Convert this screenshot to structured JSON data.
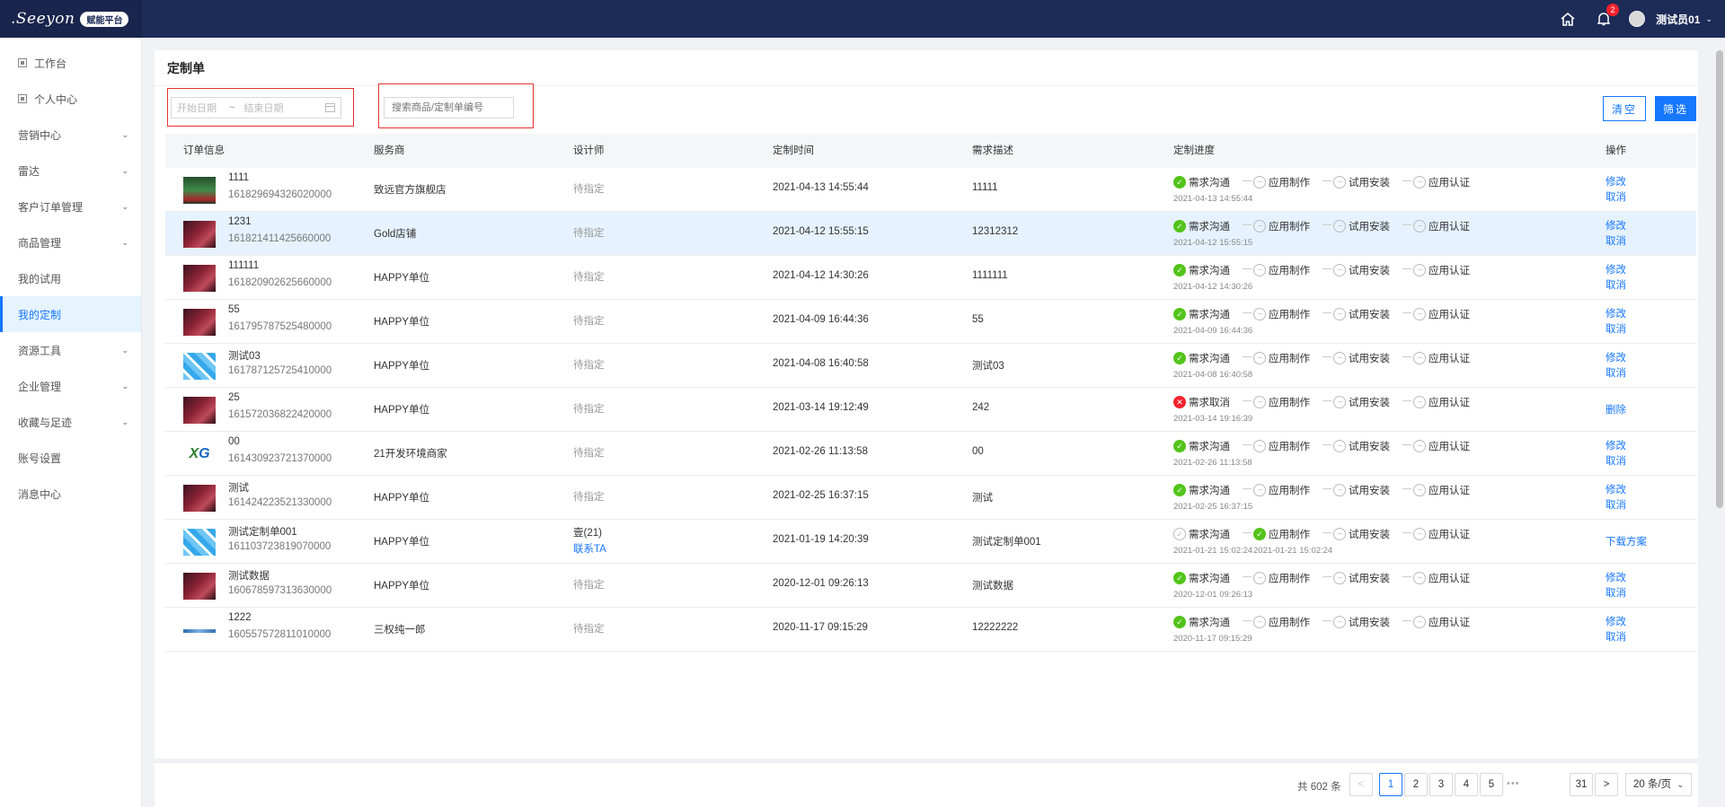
{
  "header": {
    "logo_text": ".Seeyon",
    "logo_badge": "赋能平台",
    "bell_count": "2",
    "user_name": "测试员01"
  },
  "sidebar": {
    "items": [
      {
        "label": "工作台",
        "icon": "page-icon",
        "caret": false,
        "active": false
      },
      {
        "label": "个人中心",
        "icon": "page-icon",
        "caret": false,
        "active": false
      },
      {
        "label": "营销中心",
        "caret": true,
        "active": false
      },
      {
        "label": "雷达",
        "caret": true,
        "active": false
      },
      {
        "label": "客户订单管理",
        "caret": true,
        "active": false
      },
      {
        "label": "商品管理",
        "caret": true,
        "active": false
      },
      {
        "label": "我的试用",
        "caret": false,
        "active": false
      },
      {
        "label": "我的定制",
        "caret": false,
        "active": true
      },
      {
        "label": "资源工具",
        "caret": true,
        "active": false
      },
      {
        "label": "企业管理",
        "caret": true,
        "active": false
      },
      {
        "label": "收藏与足迹",
        "caret": true,
        "active": false
      },
      {
        "label": "账号设置",
        "caret": false,
        "active": false
      },
      {
        "label": "消息中心",
        "caret": false,
        "active": false
      }
    ]
  },
  "page": {
    "title": "定制单",
    "start_placeholder": "开始日期",
    "range_sep": "~",
    "end_placeholder": "结束日期",
    "search_placeholder": "搜索商品/定制单编号",
    "clear_label": "清空",
    "filter_label": "筛选"
  },
  "table": {
    "headers": [
      "订单信息",
      "服务商",
      "设计师",
      "定制时间",
      "需求描述",
      "定制进度",
      "操作"
    ],
    "steps": [
      "需求沟通",
      "应用制作",
      "试用安装",
      "应用认证"
    ],
    "cancel_step": "需求取消",
    "rows": [
      {
        "thumb": "green",
        "name": "1111",
        "no": "161829694326020000",
        "provider": "致远官方旗舰店",
        "designer": "待指定",
        "time": "2021-04-13 14:55:44",
        "desc": "11111",
        "s1": "ok",
        "t1": "2021-04-13 14:55:44",
        "ops": [
          "修改",
          "取消"
        ]
      },
      {
        "thumb": "red",
        "name": "1231",
        "no": "161821411425660000",
        "provider": "Gold店铺",
        "designer": "待指定",
        "time": "2021-04-12 15:55:15",
        "desc": "12312312",
        "s1": "ok",
        "t1": "2021-04-12 15:55:15",
        "ops": [
          "修改",
          "取消"
        ],
        "highlight": true
      },
      {
        "thumb": "red",
        "name": "111111",
        "no": "161820902625660000",
        "provider": "HAPPY单位",
        "designer": "待指定",
        "time": "2021-04-12 14:30:26",
        "desc": "1111111",
        "s1": "ok",
        "t1": "2021-04-12 14:30:26",
        "ops": [
          "修改",
          "取消"
        ]
      },
      {
        "thumb": "red",
        "name": "55",
        "no": "161795787525480000",
        "provider": "HAPPY单位",
        "designer": "待指定",
        "time": "2021-04-09 16:44:36",
        "desc": "55",
        "s1": "ok",
        "t1": "2021-04-09 16:44:36",
        "ops": [
          "修改",
          "取消"
        ]
      },
      {
        "thumb": "blue",
        "name": "测试03",
        "no": "161787125725410000",
        "provider": "HAPPY单位",
        "designer": "待指定",
        "time": "2021-04-08 16:40:58",
        "desc": "测试03",
        "s1": "ok",
        "t1": "2021-04-08 16:40:58",
        "ops": [
          "修改",
          "取消"
        ]
      },
      {
        "thumb": "red",
        "name": "25",
        "no": "161572036822420000",
        "provider": "HAPPY单位",
        "designer": "待指定",
        "time": "2021-03-14 19:12:49",
        "desc": "242",
        "s1": "err",
        "t1": "2021-03-14 19:16:39",
        "ops": [
          "删除"
        ]
      },
      {
        "thumb": "logo",
        "name": "00",
        "no": "161430923721370000",
        "provider": "21开发环境商家",
        "designer": "待指定",
        "time": "2021-02-26 11:13:58",
        "desc": "00",
        "s1": "ok",
        "t1": "2021-02-26 11:13:58",
        "ops": [
          "修改",
          "取消"
        ]
      },
      {
        "thumb": "red",
        "name": "测试",
        "no": "161424223521330000",
        "provider": "HAPPY单位",
        "designer": "待指定",
        "time": "2021-02-25 16:37:15",
        "desc": "测试",
        "s1": "ok",
        "t1": "2021-02-25 16:37:15",
        "ops": [
          "修改",
          "取消"
        ]
      },
      {
        "thumb": "blue",
        "name": "测试定制单001",
        "no": "161103723819070000",
        "provider": "HAPPY单位",
        "designer": "壹(21)",
        "designer_link": "联系TA",
        "time": "2021-01-19 14:20:39",
        "desc": "测试定制单001",
        "s1": "okline",
        "t1": "2021-01-21 15:02:24",
        "s2": "ok",
        "t2": "2021-01-21 15:02:24",
        "ops": [
          "下载方案"
        ]
      },
      {
        "thumb": "red",
        "name": "测试数据",
        "no": "160678597313630000",
        "provider": "HAPPY单位",
        "designer": "待指定",
        "time": "2020-12-01 09:26:13",
        "desc": "测试数据",
        "s1": "ok",
        "t1": "2020-12-01 09:26:13",
        "ops": [
          "修改",
          "取消"
        ]
      },
      {
        "thumb": "line",
        "name": "1222",
        "no": "160557572811010000",
        "provider": "三权纯一郎",
        "designer": "待指定",
        "time": "2020-11-17 09:15:29",
        "desc": "12222222",
        "s1": "ok",
        "t1": "2020-11-17 09:15:29",
        "ops": [
          "修改",
          "取消"
        ]
      }
    ]
  },
  "pagination": {
    "total": "共 602 条",
    "pages": [
      "1",
      "2",
      "3",
      "4",
      "5",
      "31"
    ],
    "current": "1",
    "more": "•••",
    "prev": "<",
    "next": ">",
    "page_size": "20 条/页"
  },
  "colors": {
    "accent": "#1677ff",
    "header_bg": "#1d2b57",
    "success": "#52c41a",
    "danger": "#f5222d",
    "highlight_row": "#e6f2ff"
  }
}
